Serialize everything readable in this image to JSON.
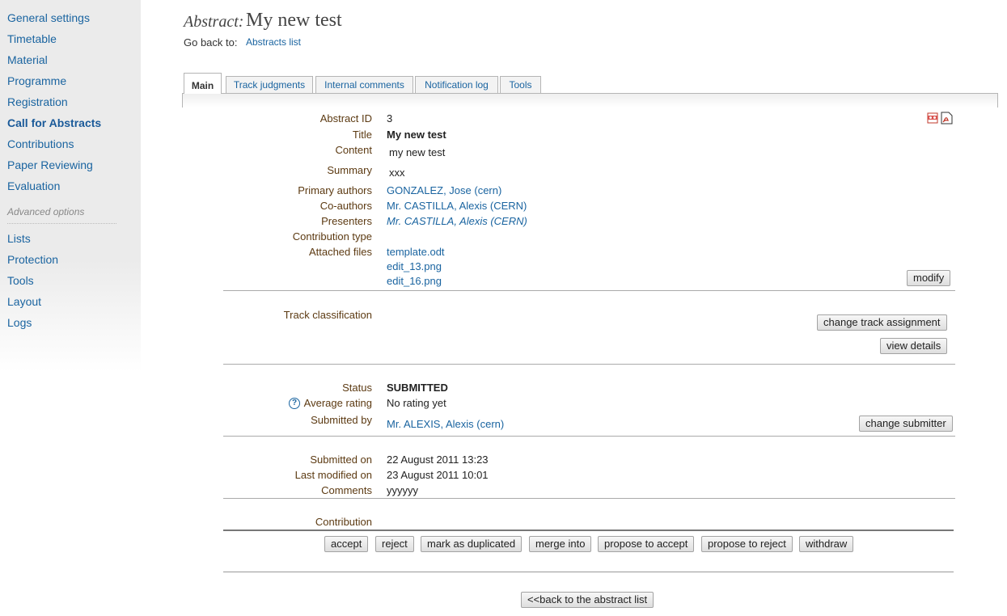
{
  "sidebar": {
    "items": [
      "General settings",
      "Timetable",
      "Material",
      "Programme",
      "Registration",
      "Call for Abstracts",
      "Contributions",
      "Paper Reviewing",
      "Evaluation"
    ],
    "advanced_label": "Advanced options",
    "advanced_items": [
      "Lists",
      "Protection",
      "Tools",
      "Layout",
      "Logs"
    ]
  },
  "header": {
    "label": "Abstract:",
    "title": "My new test",
    "goback_label": "Go back to:",
    "goback_link": "Abstracts list"
  },
  "tabs": [
    "Main",
    "Track judgments",
    "Internal comments",
    "Notification log",
    "Tools"
  ],
  "details": {
    "abstract_id_label": "Abstract ID",
    "abstract_id": "3",
    "title_label": "Title",
    "title": "My new test",
    "content_label": "Content",
    "content": "my new test",
    "summary_label": "Summary",
    "summary": "xxx",
    "primary_authors_label": "Primary authors",
    "primary_authors": "GONZALEZ, Jose (cern)",
    "coauthors_label": "Co-authors",
    "coauthors": "Mr. CASTILLA, Alexis (CERN)",
    "presenters_label": "Presenters",
    "presenters": "Mr. CASTILLA, Alexis (CERN)",
    "contribution_type_label": "Contribution type",
    "attached_files_label": "Attached files",
    "attached_files": [
      "template.odt",
      "edit_13.png",
      "edit_16.png"
    ],
    "modify_button": "modify"
  },
  "track": {
    "label": "Track classification",
    "change_button": "change track assignment",
    "view_button": "view details"
  },
  "status": {
    "status_label": "Status",
    "status": "SUBMITTED",
    "rating_label": "Average rating",
    "rating": "No rating yet",
    "submitted_by_label": "Submitted by",
    "submitted_by": "Mr. ALEXIS, Alexis (cern)",
    "change_submitter_button": "change submitter"
  },
  "dates": {
    "submitted_on_label": "Submitted on",
    "submitted_on": "22 August 2011 13:23",
    "last_modified_label": "Last modified on",
    "last_modified": "23 August 2011 10:01",
    "comments_label": "Comments",
    "comments": "yyyyyy"
  },
  "contribution_label": "Contribution",
  "actions": [
    "accept",
    "reject",
    "mark as duplicated",
    "merge into",
    "propose to accept",
    "propose to reject",
    "withdraw"
  ],
  "back_button": "<<back to the abstract list",
  "icons": [
    "xml-export-icon",
    "pdf-export-icon"
  ]
}
